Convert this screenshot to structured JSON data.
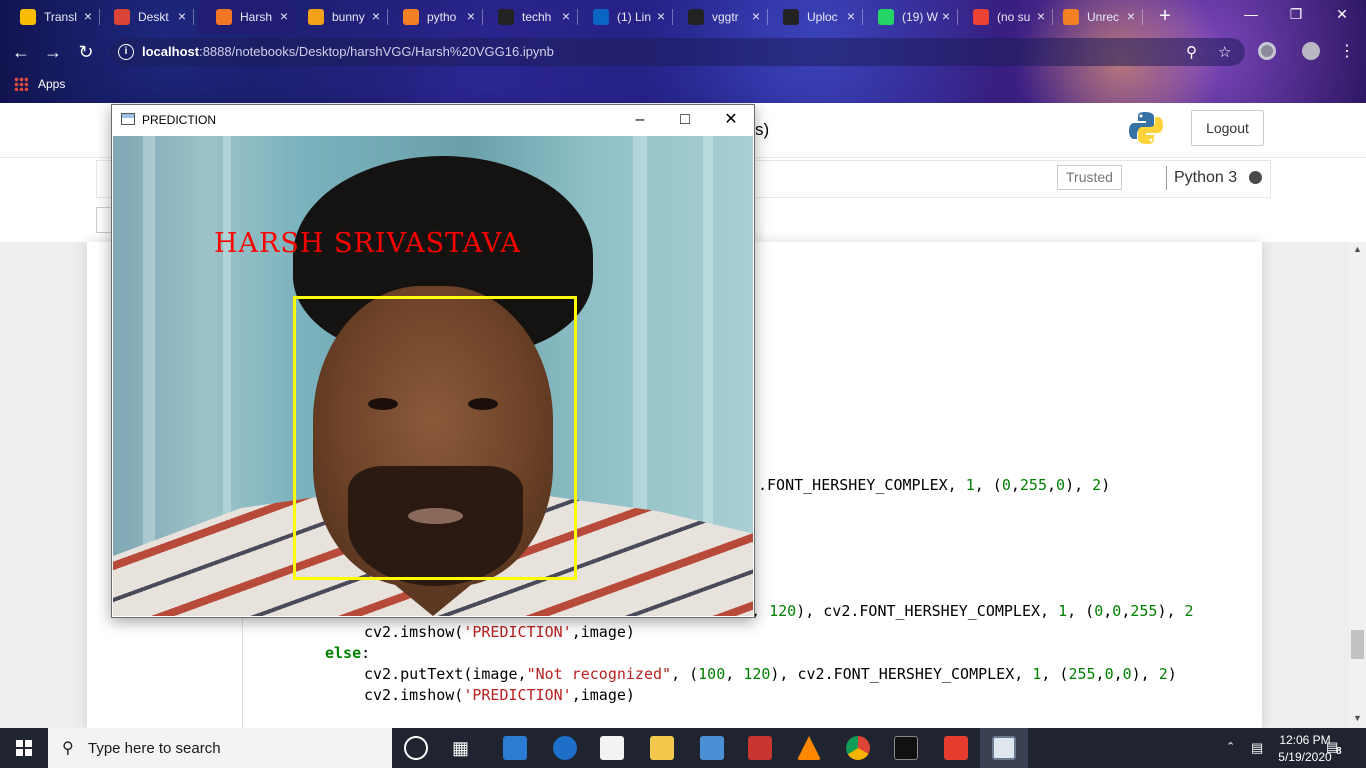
{
  "browser": {
    "tabs": [
      {
        "label": "Transl",
        "icon": "google-drive-icon",
        "color": "#fbbc04"
      },
      {
        "label": "Deskt",
        "icon": "chrome-icon",
        "color": "#db4437"
      },
      {
        "label": "Harsh",
        "icon": "jupyter-hourglass-icon",
        "color": "#f37726",
        "active": true
      },
      {
        "label": "bunny",
        "icon": "document-icon",
        "color": "#f4a11a"
      },
      {
        "label": "pytho",
        "icon": "stackoverflow-icon",
        "color": "#f48024"
      },
      {
        "label": "techh",
        "icon": "github-icon",
        "color": "#222222"
      },
      {
        "label": "(1) Lin",
        "icon": "linkedin-icon",
        "color": "#0a66c2"
      },
      {
        "label": "vggtr",
        "icon": "github-icon",
        "color": "#222222"
      },
      {
        "label": "Uploc",
        "icon": "github-icon",
        "color": "#222222"
      },
      {
        "label": "(19) W",
        "icon": "whatsapp-icon",
        "color": "#25d366"
      },
      {
        "label": "(no su",
        "icon": "gmail-icon",
        "color": "#ea4335"
      },
      {
        "label": "Unrec",
        "icon": "stackoverflow-icon",
        "color": "#f48024"
      }
    ],
    "new_tab": "+",
    "window_controls": {
      "minimize": "—",
      "restore": "❐",
      "close": "✕"
    },
    "url_host": "localhost",
    "url_rest": ":8888/notebooks/Desktop/harshVGG/Harsh%20VGG16.ipynb",
    "bookmarks_apps": "Apps"
  },
  "jupyter": {
    "title_fragment": "s)",
    "logout": "Logout",
    "trusted": "Trusted",
    "kernel": "Python 3",
    "code_lines": {
      "line1": ".FONT_HERSHEY_COMPLEX, 1, (0,255,0), 2)",
      "line2": "0, 120), cv2.FONT_HERSHEY_COMPLEX, 1, (0,0,255), 2"
    }
  },
  "prediction_window": {
    "title": "PREDICTION",
    "label": "HARSH SRIVASTAVA",
    "box_color": "#ffff00",
    "label_color": "#ff0000"
  },
  "taskbar": {
    "search_placeholder": "Type here to search",
    "time": "12:06 PM",
    "date": "5/19/2020",
    "notification_count": "8"
  }
}
